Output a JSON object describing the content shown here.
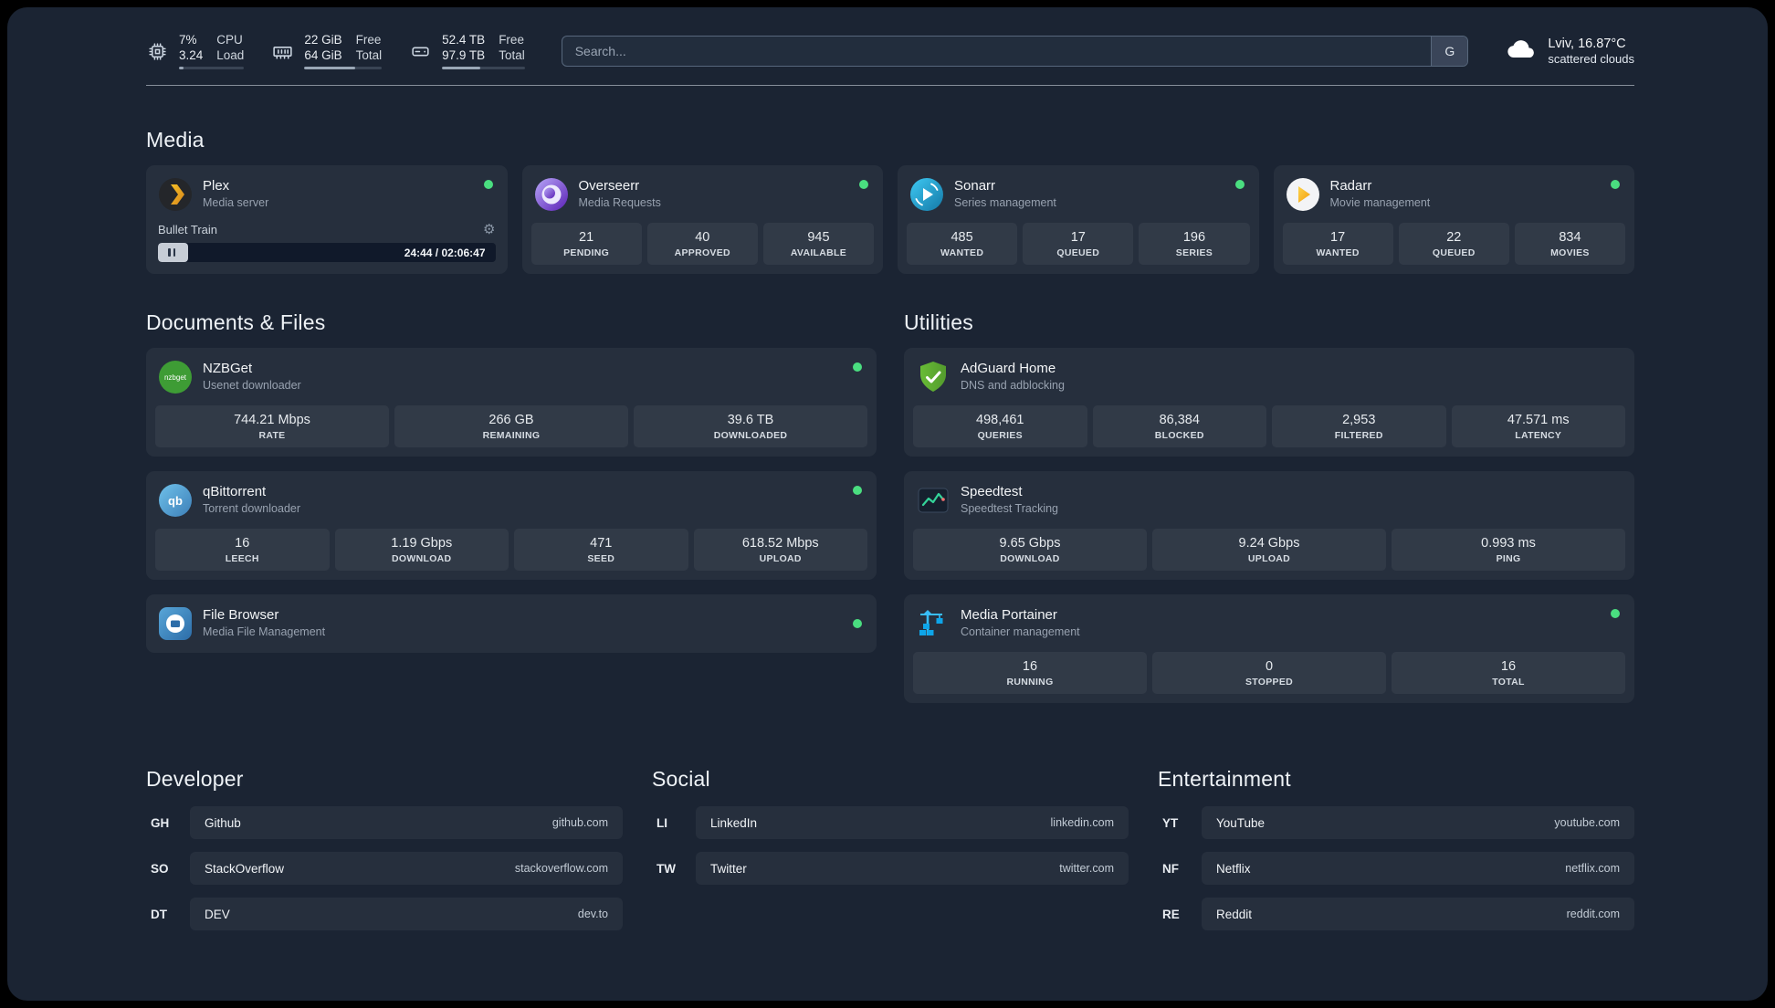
{
  "topbar": {
    "cpu": {
      "values": [
        "7%",
        "3.24"
      ],
      "labels": [
        "CPU",
        "Load"
      ],
      "progress": 7
    },
    "memory": {
      "values": [
        "22 GiB",
        "64 GiB"
      ],
      "labels": [
        "Free",
        "Total"
      ],
      "progress": 66
    },
    "disk": {
      "values": [
        "52.4 TB",
        "97.9 TB"
      ],
      "labels": [
        "Free",
        "Total"
      ],
      "progress": 46
    },
    "search": {
      "placeholder": "Search...",
      "provider": "G"
    },
    "weather": {
      "location": "Lviv, 16.87°C",
      "condition": "scattered clouds"
    }
  },
  "icons": {
    "gear": "⚙"
  },
  "colors": {
    "status_online": "#4ade80",
    "accent_green": "#34d399"
  },
  "sections": {
    "media": {
      "title": "Media",
      "cards": [
        {
          "name": "Plex",
          "desc": "Media server",
          "status": "online",
          "player": {
            "track": "Bullet Train",
            "time": "24:44 / 02:06:47",
            "progress": 9
          }
        },
        {
          "name": "Overseerr",
          "desc": "Media Requests",
          "status": "online",
          "stats": [
            {
              "value": "21",
              "label": "PENDING"
            },
            {
              "value": "40",
              "label": "APPROVED"
            },
            {
              "value": "945",
              "label": "AVAILABLE"
            }
          ]
        },
        {
          "name": "Sonarr",
          "desc": "Series management",
          "status": "online",
          "stats": [
            {
              "value": "485",
              "label": "WANTED"
            },
            {
              "value": "17",
              "label": "QUEUED"
            },
            {
              "value": "196",
              "label": "SERIES"
            }
          ]
        },
        {
          "name": "Radarr",
          "desc": "Movie management",
          "status": "online",
          "stats": [
            {
              "value": "17",
              "label": "WANTED"
            },
            {
              "value": "22",
              "label": "QUEUED"
            },
            {
              "value": "834",
              "label": "MOVIES"
            }
          ]
        }
      ]
    },
    "documents": {
      "title": "Documents & Files",
      "cards": [
        {
          "name": "NZBGet",
          "desc": "Usenet downloader",
          "icon_label": "nzbget",
          "status": "online",
          "stats": [
            {
              "value": "744.21 Mbps",
              "label": "RATE"
            },
            {
              "value": "266 GB",
              "label": "REMAINING"
            },
            {
              "value": "39.6 TB",
              "label": "DOWNLOADED"
            }
          ]
        },
        {
          "name": "qBittorrent",
          "desc": "Torrent downloader",
          "icon_label": "qb",
          "status": "online",
          "stats": [
            {
              "value": "16",
              "label": "LEECH"
            },
            {
              "value": "1.19 Gbps",
              "label": "DOWNLOAD"
            },
            {
              "value": "471",
              "label": "SEED"
            },
            {
              "value": "618.52 Mbps",
              "label": "UPLOAD"
            }
          ]
        },
        {
          "name": "File Browser",
          "desc": "Media File Management",
          "status": "online"
        }
      ]
    },
    "utilities": {
      "title": "Utilities",
      "cards": [
        {
          "name": "AdGuard Home",
          "desc": "DNS and adblocking",
          "stats": [
            {
              "value": "498,461",
              "label": "QUERIES"
            },
            {
              "value": "86,384",
              "label": "BLOCKED"
            },
            {
              "value": "2,953",
              "label": "FILTERED"
            },
            {
              "value": "47.571 ms",
              "label": "LATENCY"
            }
          ]
        },
        {
          "name": "Speedtest",
          "desc": "Speedtest Tracking",
          "stats": [
            {
              "value": "9.65 Gbps",
              "label": "DOWNLOAD"
            },
            {
              "value": "9.24 Gbps",
              "label": "UPLOAD"
            },
            {
              "value": "0.993 ms",
              "label": "PING"
            }
          ]
        },
        {
          "name": "Media Portainer",
          "desc": "Container management",
          "status": "online",
          "stats": [
            {
              "value": "16",
              "label": "RUNNING"
            },
            {
              "value": "0",
              "label": "STOPPED"
            },
            {
              "value": "16",
              "label": "TOTAL"
            }
          ]
        }
      ]
    },
    "bookmarks": [
      {
        "title": "Developer",
        "items": [
          {
            "abbr": "GH",
            "name": "Github",
            "domain": "github.com"
          },
          {
            "abbr": "SO",
            "name": "StackOverflow",
            "domain": "stackoverflow.com"
          },
          {
            "abbr": "DT",
            "name": "DEV",
            "domain": "dev.to"
          }
        ]
      },
      {
        "title": "Social",
        "items": [
          {
            "abbr": "LI",
            "name": "LinkedIn",
            "domain": "linkedin.com"
          },
          {
            "abbr": "TW",
            "name": "Twitter",
            "domain": "twitter.com"
          }
        ]
      },
      {
        "title": "Entertainment",
        "items": [
          {
            "abbr": "YT",
            "name": "YouTube",
            "domain": "youtube.com"
          },
          {
            "abbr": "NF",
            "name": "Netflix",
            "domain": "netflix.com"
          },
          {
            "abbr": "RE",
            "name": "Reddit",
            "domain": "reddit.com"
          }
        ]
      }
    ]
  }
}
